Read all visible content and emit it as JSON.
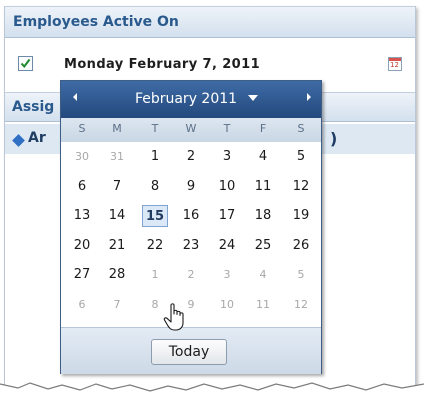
{
  "employees_section": {
    "title": "Employees Active On",
    "checked": true,
    "date_text": "Monday February 7, 2011",
    "calendar_icon_label": "12"
  },
  "assign_section": {
    "title_visible": "Assig",
    "row_label_visible": "Ar",
    "row_suffix_visible": ")"
  },
  "date_picker": {
    "month_year": "February 2011",
    "weekdays": [
      "S",
      "M",
      "T",
      "W",
      "T",
      "F",
      "S"
    ],
    "weeks": [
      [
        {
          "d": "30",
          "o": true
        },
        {
          "d": "31",
          "o": true
        },
        {
          "d": "1"
        },
        {
          "d": "2"
        },
        {
          "d": "3"
        },
        {
          "d": "4"
        },
        {
          "d": "5"
        }
      ],
      [
        {
          "d": "6"
        },
        {
          "d": "7"
        },
        {
          "d": "8"
        },
        {
          "d": "9"
        },
        {
          "d": "10"
        },
        {
          "d": "11"
        },
        {
          "d": "12"
        }
      ],
      [
        {
          "d": "13"
        },
        {
          "d": "14"
        },
        {
          "d": "15",
          "s": true
        },
        {
          "d": "16"
        },
        {
          "d": "17"
        },
        {
          "d": "18"
        },
        {
          "d": "19"
        }
      ],
      [
        {
          "d": "20"
        },
        {
          "d": "21"
        },
        {
          "d": "22"
        },
        {
          "d": "23"
        },
        {
          "d": "24"
        },
        {
          "d": "25"
        },
        {
          "d": "26"
        }
      ],
      [
        {
          "d": "27"
        },
        {
          "d": "28"
        },
        {
          "d": "1",
          "o": true
        },
        {
          "d": "2",
          "o": true
        },
        {
          "d": "3",
          "o": true
        },
        {
          "d": "4",
          "o": true
        },
        {
          "d": "5",
          "o": true
        }
      ],
      [
        {
          "d": "6",
          "o": true
        },
        {
          "d": "7",
          "o": true
        },
        {
          "d": "8",
          "o": true
        },
        {
          "d": "9",
          "o": true
        },
        {
          "d": "10",
          "o": true
        },
        {
          "d": "11",
          "o": true
        },
        {
          "d": "12",
          "o": true
        }
      ]
    ],
    "today_button": "Today"
  },
  "colors": {
    "header_text": "#2a5a8d",
    "picker_header": "#2f5a91",
    "selected_day_bg": "#dbe8f7"
  }
}
